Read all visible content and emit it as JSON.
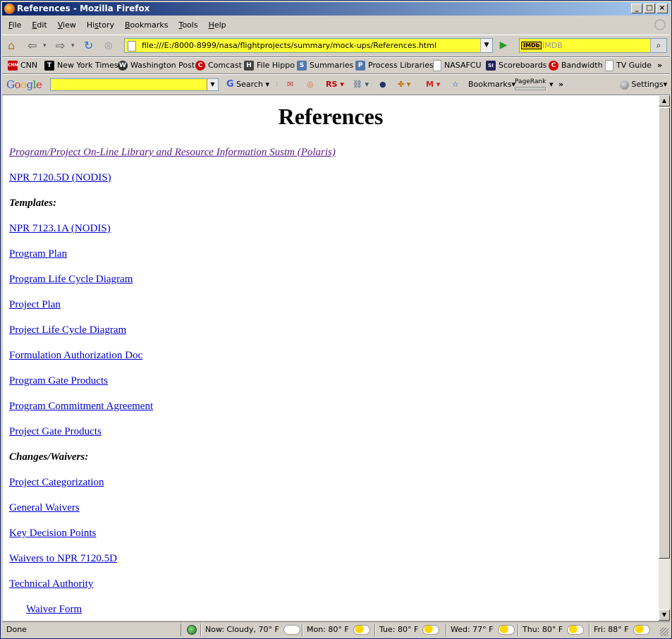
{
  "window": {
    "title": "References - Mozilla Firefox"
  },
  "menu": [
    {
      "key": "F",
      "rest": "ile"
    },
    {
      "key": "E",
      "rest": "dit"
    },
    {
      "key": "V",
      "rest": "iew"
    },
    {
      "key": "",
      "rest": "History",
      "pre": "Hi",
      "ul": "s",
      "post": "tory"
    },
    {
      "key": "B",
      "rest": "ookmarks"
    },
    {
      "key": "T",
      "rest": "ools"
    },
    {
      "key": "H",
      "rest": "elp"
    }
  ],
  "nav": {
    "url": "file:///E:/8000-8999/nasa/flightprojects/summary/mock-ups/References.html",
    "search_placeholder": "IMDB",
    "search_engine": "IMDb"
  },
  "bookmarks": [
    {
      "label": "CNN",
      "icon": "cnn-icon",
      "color": "#cc0000",
      "glyph": "CNN"
    },
    {
      "label": "New York Times",
      "icon": "nyt-icon",
      "color": "#000000",
      "glyph": "T"
    },
    {
      "label": "Washington Post",
      "icon": "wapo-icon",
      "color": "#333333",
      "glyph": "W"
    },
    {
      "label": "Comcast",
      "icon": "comcast-icon",
      "color": "#cc0000",
      "glyph": "C"
    },
    {
      "label": "File Hippo",
      "icon": "filehippo-icon",
      "color": "#444444",
      "glyph": "H"
    },
    {
      "label": "Summaries",
      "icon": "page-icon",
      "color": "#5577aa",
      "glyph": "S"
    },
    {
      "label": "Process Libraries",
      "icon": "page-icon",
      "color": "#5577aa",
      "glyph": "P"
    },
    {
      "label": "NASAFCU",
      "icon": "blank-page-icon",
      "color": "#bbbbbb",
      "glyph": ""
    },
    {
      "label": "Scoreboards",
      "icon": "si-icon",
      "color": "#222255",
      "glyph": "SI"
    },
    {
      "label": "Bandwidth",
      "icon": "bandwidth-icon",
      "color": "#dd0000",
      "glyph": "C"
    },
    {
      "label": "TV Guide",
      "icon": "blank-page-icon",
      "color": "#bbbbbb",
      "glyph": ""
    }
  ],
  "google_toolbar": {
    "logo": "Google",
    "search_label": "Search",
    "bookmarks_label": "Bookmarks",
    "pagerank_label": "PageRank",
    "settings_label": "Settings"
  },
  "page": {
    "heading": "References",
    "items": [
      {
        "type": "link",
        "text": "Program/Project On-Line Library and Resource Information Sustm (Polaris)",
        "visited": true
      },
      {
        "type": "link",
        "text": "NPR 7120.5D (NODIS)"
      },
      {
        "type": "section",
        "text": "Templates:"
      },
      {
        "type": "link",
        "text": "NPR 7123.1A (NODIS)"
      },
      {
        "type": "link",
        "text": "Program Plan"
      },
      {
        "type": "link",
        "text": "Program Life Cycle Diagram"
      },
      {
        "type": "link",
        "text": "Project Plan"
      },
      {
        "type": "link",
        "text": "Project Life Cycle Diagram"
      },
      {
        "type": "link",
        "text": "Formulation Authorization Doc"
      },
      {
        "type": "link",
        "text": "Program Gate Products"
      },
      {
        "type": "link",
        "text": "Program Commitment Agreement"
      },
      {
        "type": "link",
        "text": "Project Gate Products"
      },
      {
        "type": "section",
        "text": "Changes/Waivers:"
      },
      {
        "type": "link",
        "text": "Project Categorization"
      },
      {
        "type": "link",
        "text": "General Waivers"
      },
      {
        "type": "link",
        "text": "Key Decision Points"
      },
      {
        "type": "link",
        "text": "Waivers to NPR 7120.5D"
      },
      {
        "type": "link",
        "text": "Technical Authority"
      },
      {
        "type": "link",
        "text": "Waiver Form",
        "indent": true
      }
    ]
  },
  "status": {
    "text": "Done",
    "weather": [
      {
        "label": "Now: Cloudy, 70° F",
        "icon": "cloud-icon"
      },
      {
        "label": "Mon: 80° F",
        "icon": "partly-sunny-icon"
      },
      {
        "label": "Tue: 80° F",
        "icon": "partly-sunny-icon"
      },
      {
        "label": "Wed: 77° F",
        "icon": "partly-sunny-icon"
      },
      {
        "label": "Thu: 80° F",
        "icon": "partly-sunny-icon"
      },
      {
        "label": "Fri: 88° F",
        "icon": "partly-sunny-icon"
      }
    ]
  }
}
